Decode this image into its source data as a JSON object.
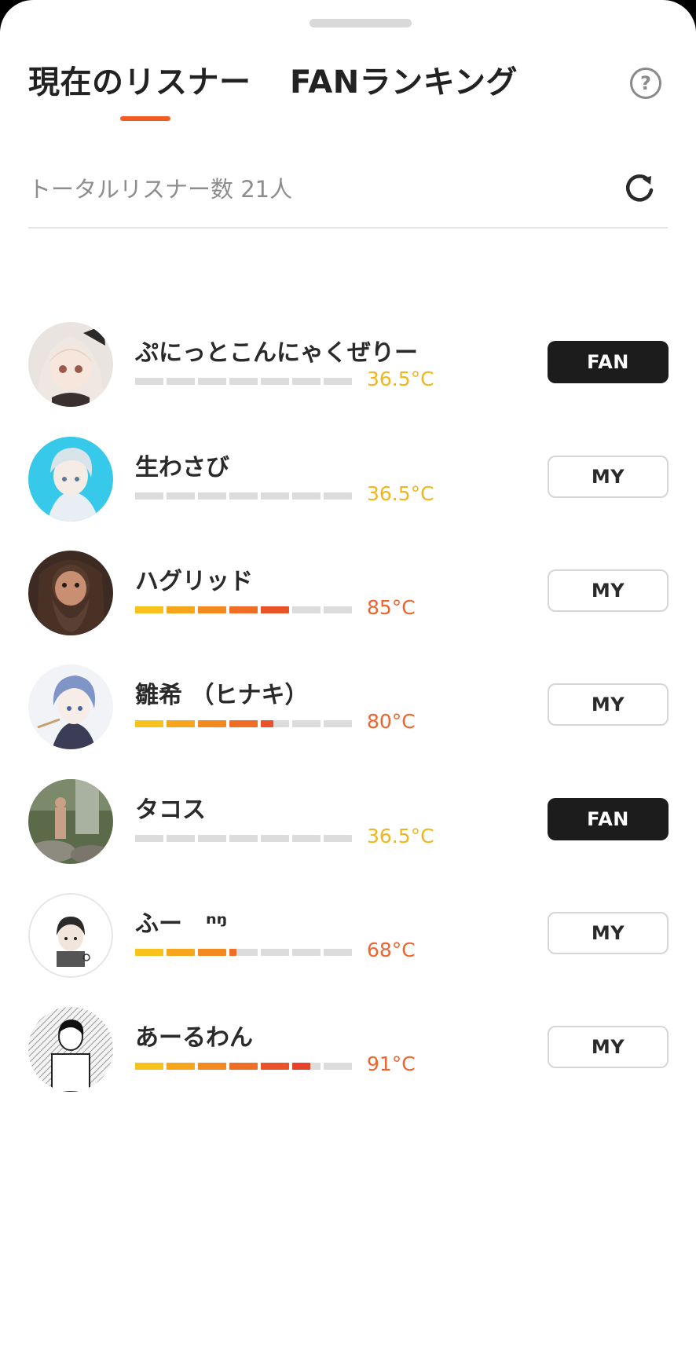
{
  "tabs": {
    "current_listeners": "現在のリスナー",
    "fan_ranking": "FANランキング"
  },
  "help_label": "?",
  "listeners": {
    "total_label": "トータルリスナー数 21人",
    "items": [
      {
        "name": "ぷにっとこんにゃくぜりー",
        "temperature": "36.5°C",
        "temp_value": 36.5,
        "level": 0,
        "temp_color": "#f2b51c",
        "badge": "FAN",
        "badge_style": "fan",
        "avatar_icon": "avatar-anime-girl"
      },
      {
        "name": "生わさび",
        "temperature": "36.5°C",
        "temp_value": 36.5,
        "level": 0,
        "temp_color": "#f2b51c",
        "badge": "MY",
        "badge_style": "my",
        "avatar_icon": "avatar-anime-boy"
      },
      {
        "name": "ハグリッド",
        "temperature": "85°C",
        "temp_value": 85,
        "level": 5,
        "temp_color": "#f0632a",
        "badge": "MY",
        "badge_style": "my",
        "avatar_icon": "avatar-bearded-man"
      },
      {
        "name": "雛希 （ヒナキ）",
        "temperature": "80°C",
        "temp_value": 80,
        "level": 4.45,
        "temp_color": "#f0632a",
        "badge": "MY",
        "badge_style": "my",
        "avatar_icon": "avatar-anime-bluehair"
      },
      {
        "name": "タコス",
        "temperature": "36.5°C",
        "temp_value": 36.5,
        "level": 0,
        "temp_color": "#f2b51c",
        "badge": "FAN",
        "badge_style": "fan",
        "avatar_icon": "avatar-photo-outdoor"
      },
      {
        "name": "ふー　ⁿᵑ",
        "temperature": "68°C",
        "temp_value": 68,
        "level": 3.25,
        "temp_color": "#f0632a",
        "badge": "MY",
        "badge_style": "my",
        "avatar_icon": "avatar-cartoon-boy"
      },
      {
        "name": "あーるわん",
        "temperature": "91°C",
        "temp_value": 91,
        "level": 5.65,
        "temp_color": "#f0632a",
        "badge": "MY",
        "badge_style": "my",
        "avatar_icon": "avatar-manga"
      }
    ]
  },
  "meter_colors": [
    "#f7c21a",
    "#f6a51c",
    "#f38a1f",
    "#ef6d24",
    "#ea5328",
    "#e4422a",
    "#dcdcdc"
  ]
}
